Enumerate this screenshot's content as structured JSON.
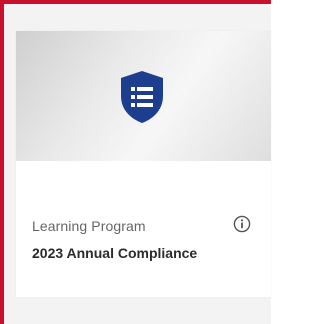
{
  "card": {
    "type_label": "Learning Program",
    "title": "2023 Annual Compliance",
    "icon": "shield-list-icon",
    "info_icon": "info-icon"
  },
  "colors": {
    "selection_border": "#c8102e",
    "shield": "#1d3d8f"
  }
}
